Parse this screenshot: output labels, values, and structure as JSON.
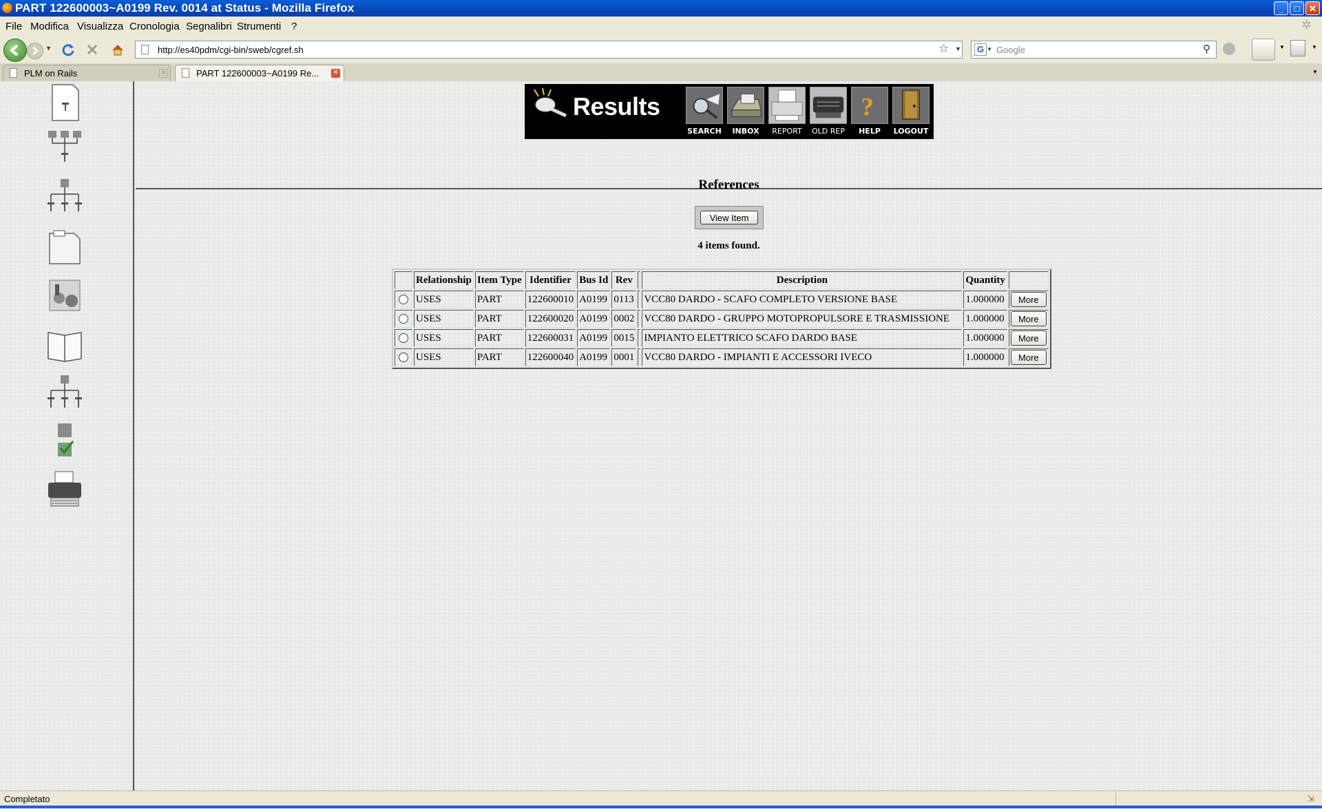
{
  "window": {
    "title": "PART 122600003~A0199 Rev. 0014 at Status  - Mozilla Firefox",
    "buttons": [
      "_",
      "□",
      "✕"
    ]
  },
  "menu": [
    "File",
    "Modifica",
    "Visualizza",
    "Cronologia",
    "Segnalibri",
    "Strumenti",
    "?"
  ],
  "navbar": {
    "url": "http://es40pdm/cgi-bin/sweb/cgref.sh",
    "search_placeholder": "Google"
  },
  "tabs": [
    {
      "label": "PLM on Rails",
      "active": false
    },
    {
      "label": "PART 122600003~A0199 Re...",
      "active": true
    }
  ],
  "sidebar_icons": [
    "item-icon",
    "where-used-icon",
    "structure-icon",
    "documents-icon",
    "attachments-icon",
    "manual-icon",
    "bom-icon",
    "checklist-icon",
    "print-icon"
  ],
  "banner": {
    "title": "Results",
    "buttons": [
      {
        "label": "SEARCH",
        "icon": "search-icon"
      },
      {
        "label": "INBOX",
        "icon": "inbox-icon"
      },
      {
        "label": "REPORT",
        "icon": "report-icon"
      },
      {
        "label": "OLD REP",
        "icon": "old-report-icon"
      },
      {
        "label": "HELP",
        "icon": "help-icon"
      },
      {
        "label": "LOGOUT",
        "icon": "logout-icon"
      }
    ]
  },
  "main": {
    "heading": "References",
    "view_button": "View Item",
    "count_text": "4 items found.",
    "columns": [
      "Relationship",
      "Item Type",
      "Identifier",
      "Bus Id",
      "Rev",
      "Description",
      "Quantity"
    ],
    "more_label": "More",
    "rows": [
      {
        "relationship": "USES",
        "item_type": "PART",
        "identifier": "122600010",
        "bus_id": "A0199",
        "rev": "0113",
        "description": "VCC80 DARDO - SCAFO COMPLETO VERSIONE BASE",
        "quantity": "1.000000"
      },
      {
        "relationship": "USES",
        "item_type": "PART",
        "identifier": "122600020",
        "bus_id": "A0199",
        "rev": "0002",
        "description": "VCC80 DARDO - GRUPPO MOTOPROPULSORE E TRASMISSIONE",
        "quantity": "1.000000"
      },
      {
        "relationship": "USES",
        "item_type": "PART",
        "identifier": "122600031",
        "bus_id": "A0199",
        "rev": "0015",
        "description": "IMPIANTO ELETTRICO SCAFO DARDO BASE",
        "quantity": "1.000000"
      },
      {
        "relationship": "USES",
        "item_type": "PART",
        "identifier": "122600040",
        "bus_id": "A0199",
        "rev": "0001",
        "description": "VCC80 DARDO - IMPIANTI E ACCESSORI IVECO",
        "quantity": "1.000000"
      }
    ]
  },
  "status": "Completato"
}
